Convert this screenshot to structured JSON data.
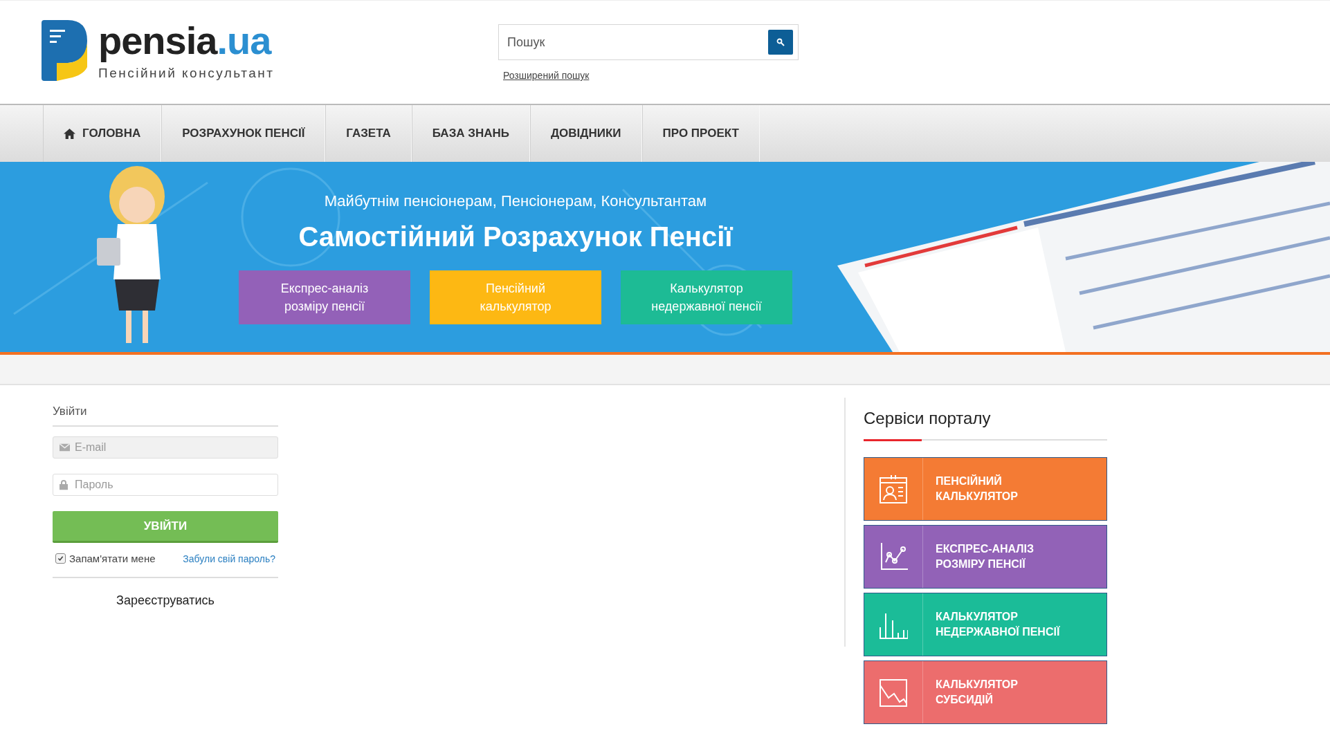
{
  "logo": {
    "name": "pensia",
    "domain": ".ua",
    "tagline": "Пенсійний консультант"
  },
  "search": {
    "placeholder": "Пошук",
    "advanced_link": "Розширений пошук"
  },
  "nav": [
    {
      "label": "ГОЛОВНА",
      "kind": "home"
    },
    {
      "label": "РОЗРАХУНОК ПЕНСІЇ",
      "kind": "text"
    },
    {
      "label": "ГАЗЕТА",
      "kind": "text"
    },
    {
      "label": "БАЗА ЗНАНЬ",
      "kind": "text"
    },
    {
      "label": "ДОВІДНИКИ",
      "kind": "text"
    },
    {
      "label": "ПРО ПРОЕКТ",
      "kind": "text"
    }
  ],
  "banner": {
    "subtitle": "Майбутнім пенсіонерам, Пенсіонерам, Консультантам",
    "title": "Самостійний Розрахунок Пенсії",
    "buttons": [
      {
        "label": "Експрес-аналіз\nрозміру пенсії",
        "color": "#9361b8"
      },
      {
        "label": "Пенсійний\nкалькулятор",
        "color": "#fdb813"
      },
      {
        "label": "Калькулятор\nнедержавної пенсії",
        "color": "#1dbb95"
      }
    ]
  },
  "login": {
    "title": "Увійти",
    "email_placeholder": "E-mail",
    "password_placeholder": "Пароль",
    "submit": "УВІЙТИ",
    "remember": {
      "label": "Запам'ятати мене",
      "checked": true
    },
    "forgot_link": "Забули свій пароль?",
    "register_link": "Зареєструватись"
  },
  "services": {
    "title": "Сервіси порталу",
    "items": [
      {
        "label": "ПЕНСІЙНИЙ\nКАЛЬКУЛЯТОР",
        "color": "#f47b34",
        "kind": "id-card"
      },
      {
        "label": "ЕКСПРЕС-АНАЛІЗ\nРОЗМІРУ ПЕНСІЇ",
        "color": "#9262b7",
        "kind": "line-chart"
      },
      {
        "label": "КАЛЬКУЛЯТОР\nНЕДЕРЖАВНОЇ ПЕНСІЇ",
        "color": "#1bbc98",
        "kind": "bar-chart"
      },
      {
        "label": "КАЛЬКУЛЯТОР\nСУБСИДІЙ",
        "color": "#ec6d6d",
        "kind": "falling-chart"
      }
    ]
  }
}
